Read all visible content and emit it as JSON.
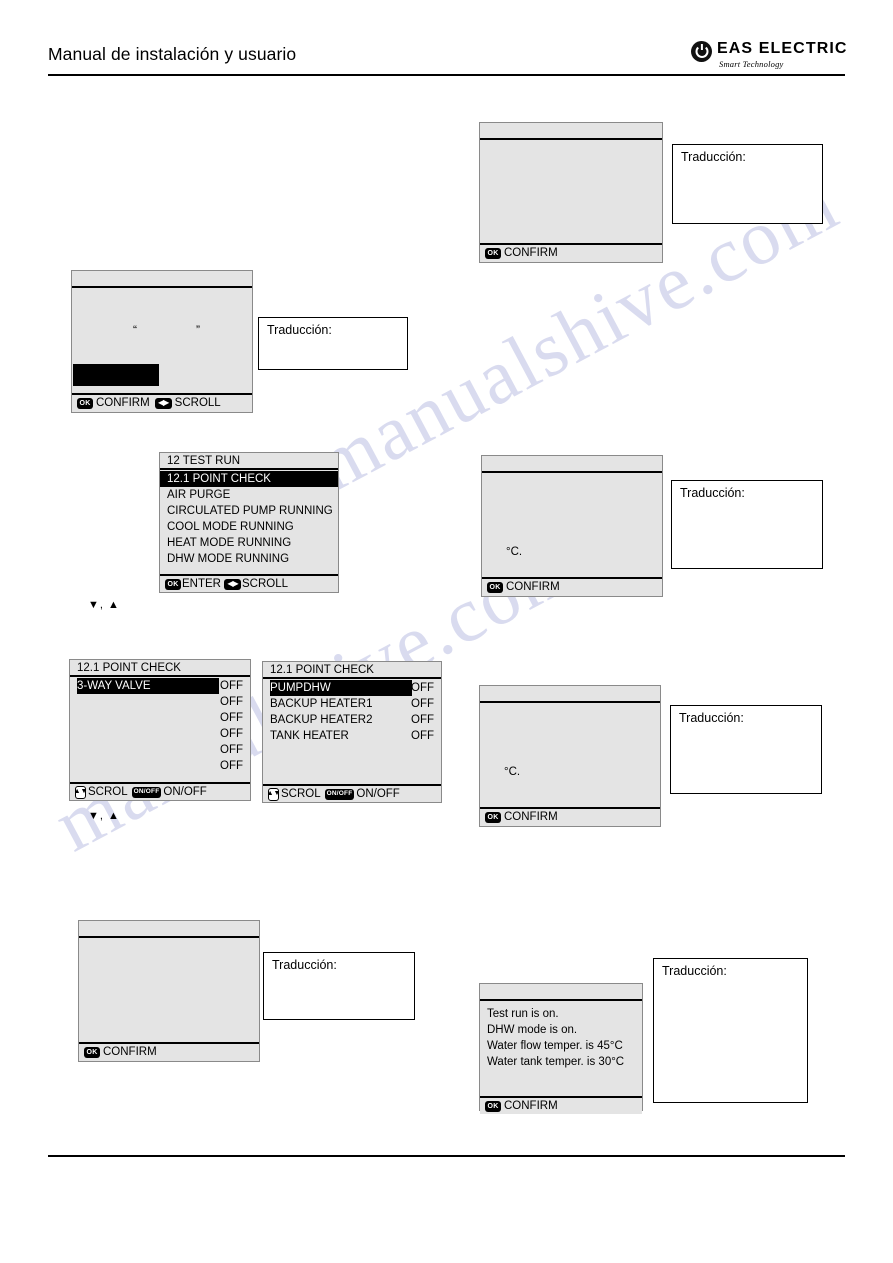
{
  "page": {
    "header_title": "Manual de instalación y usuario",
    "brand_name": "EAS  ELECTRIC",
    "brand_tagline": "Smart Technology",
    "brand_icon": "power-circle-icon",
    "watermark_text": "manualshive.com"
  },
  "labels": {
    "traduccion": "Traducción:",
    "confirm": "CONFIRM",
    "scroll": "SCROLL",
    "scrol": "SCROL",
    "enter": "ENTER",
    "onoff": "ON/OFF",
    "badge_ok": "OK",
    "badge_lr": "◀▶",
    "badge_ud": "▲▼",
    "badge_onoff": "ON/OFF",
    "arrow_pair": "▼, ▲",
    "quote_open": "“",
    "quote_close": "”",
    "degree_c": "°C."
  },
  "screens": {
    "s1_top_right": {
      "name": "blank-confirm-screen",
      "title": "",
      "body_lines": [],
      "footer": [
        {
          "badge": "OK",
          "label": "CONFIRM"
        }
      ]
    },
    "s2_left_quotes": {
      "name": "quotes-confirm-scroll-screen",
      "title": "",
      "body_lines": [],
      "quotes": [
        "“",
        "”"
      ],
      "footer": [
        {
          "badge": "OK",
          "label": "CONFIRM"
        },
        {
          "badge": "◀▶",
          "label": "SCROLL"
        }
      ]
    },
    "s3_test_run": {
      "name": "test-run-menu-screen",
      "title": "12 TEST RUN",
      "items": [
        {
          "label": "12.1 POINT CHECK",
          "selected": true
        },
        {
          "label": "AIR PURGE",
          "selected": false
        },
        {
          "label": "CIRCULATED PUMP RUNNING",
          "selected": false
        },
        {
          "label": "COOL MODE RUNNING",
          "selected": false
        },
        {
          "label": "HEAT MODE RUNNING",
          "selected": false
        },
        {
          "label": "DHW MODE RUNNING",
          "selected": false
        }
      ],
      "footer": [
        {
          "badge": "OK",
          "label": "ENTER"
        },
        {
          "badge": "◀▶",
          "label": "SCROLL"
        }
      ]
    },
    "s4_point_check_a": {
      "name": "point-check-screen-a",
      "title": "12.1 POINT CHECK",
      "items": [
        {
          "label": "3-WAY VALVE",
          "value": "OFF",
          "selected": true
        },
        {
          "label": "",
          "value": "OFF",
          "selected": false
        },
        {
          "label": "",
          "value": "OFF",
          "selected": false
        },
        {
          "label": "",
          "value": "OFF",
          "selected": false
        },
        {
          "label": "",
          "value": "OFF",
          "selected": false
        },
        {
          "label": "",
          "value": "OFF",
          "selected": false
        }
      ],
      "footer": [
        {
          "badge": "▲▼",
          "label": "SCROL"
        },
        {
          "badge": "ON/OFF",
          "label": "ON/OFF"
        }
      ]
    },
    "s5_point_check_b": {
      "name": "point-check-screen-b",
      "title": "12.1 POINT CHECK",
      "items": [
        {
          "label": "PUMPDHW",
          "value": "OFF",
          "selected": true
        },
        {
          "label": "BACKUP HEATER1",
          "value": "OFF",
          "selected": false
        },
        {
          "label": "BACKUP HEATER2",
          "value": "OFF",
          "selected": false
        },
        {
          "label": "TANK HEATER",
          "value": "OFF",
          "selected": false
        }
      ],
      "footer": [
        {
          "badge": "▲▼",
          "label": "SCROL"
        },
        {
          "badge": "ON/OFF",
          "label": "ON/OFF"
        }
      ]
    },
    "s6_degc_right_mid": {
      "name": "temperature-confirm-screen-1",
      "title": "",
      "body_lines": [
        "°C."
      ],
      "footer": [
        {
          "badge": "OK",
          "label": "CONFIRM"
        }
      ]
    },
    "s7_degc_right_low": {
      "name": "temperature-confirm-screen-2",
      "title": "",
      "body_lines": [
        "°C."
      ],
      "footer": [
        {
          "badge": "OK",
          "label": "CONFIRM"
        }
      ]
    },
    "s8_bottom_left": {
      "name": "blank-confirm-screen-2",
      "title": "",
      "body_lines": [],
      "footer": [
        {
          "badge": "OK",
          "label": "CONFIRM"
        }
      ]
    },
    "s9_status": {
      "name": "test-run-status-screen",
      "title": "",
      "body_lines": [
        "Test run is on.",
        "DHW mode is on.",
        "Water flow temper. is 45°C",
        "Water tank temper. is 30°C"
      ],
      "footer": [
        {
          "badge": "OK",
          "label": "CONFIRM"
        }
      ]
    }
  },
  "annotations": [
    {
      "name": "arrow-annotation-1",
      "text": "▼, ▲"
    },
    {
      "name": "arrow-annotation-2",
      "text": "▼, ▲"
    }
  ]
}
